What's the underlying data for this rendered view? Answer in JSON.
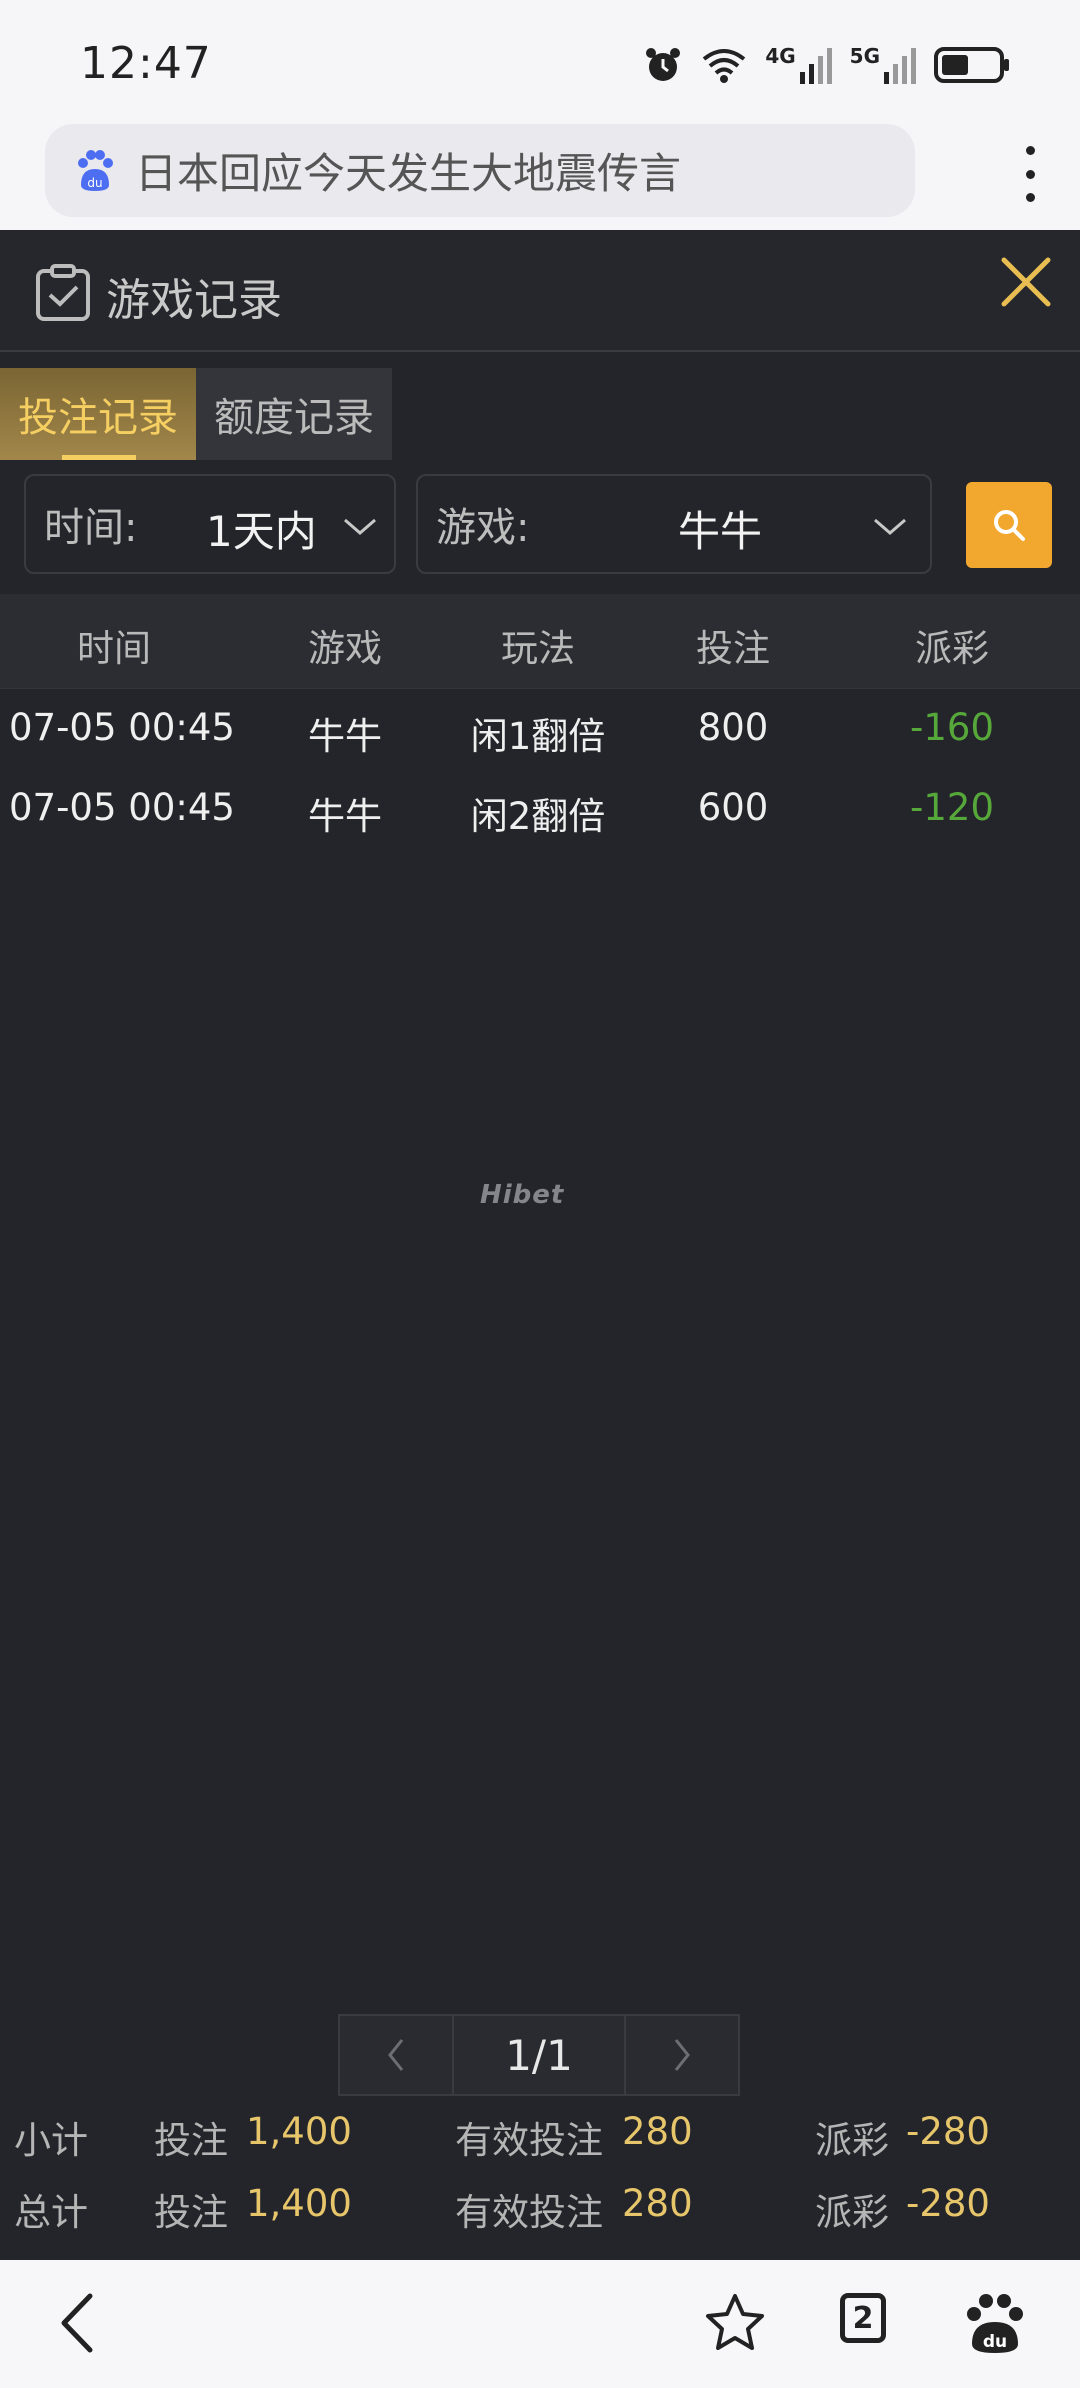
{
  "status_bar": {
    "time": "12:47",
    "net1": "4G",
    "net2": "5G"
  },
  "address_bar": {
    "text": "日本回应今天发生大地震传言"
  },
  "header": {
    "title": "游戏记录"
  },
  "tabs": [
    {
      "label": "投注记录",
      "active": true
    },
    {
      "label": "额度记录",
      "active": false
    }
  ],
  "filters": {
    "time_label": "时间:",
    "time_value": "1天内",
    "game_label": "游戏:",
    "game_value": "牛牛"
  },
  "table": {
    "columns": [
      "时间",
      "游戏",
      "玩法",
      "投注",
      "派彩"
    ],
    "rows": [
      {
        "time": "07-05 00:45",
        "game": "牛牛",
        "play": "闲1翻倍",
        "bet": "800",
        "payout": "-160"
      },
      {
        "time": "07-05 00:45",
        "game": "牛牛",
        "play": "闲2翻倍",
        "bet": "600",
        "payout": "-120"
      }
    ]
  },
  "watermark": "Hibet",
  "pagination": {
    "current": "1/1"
  },
  "summary": [
    {
      "label": "小计",
      "bet_label": "投注",
      "bet": "1,400",
      "valid_label": "有效投注",
      "valid": "280",
      "payout_label": "派彩",
      "payout": "-280"
    },
    {
      "label": "总计",
      "bet_label": "投注",
      "bet": "1,400",
      "valid_label": "有效投注",
      "valid": "280",
      "payout_label": "派彩",
      "payout": "-280"
    }
  ],
  "bottom_nav": {
    "tab_count": "2"
  },
  "colors": {
    "accent": "#f2a82f",
    "gold_text": "#e7c66b",
    "loss_green": "#57a83a",
    "panel_bg": "#24252a"
  }
}
